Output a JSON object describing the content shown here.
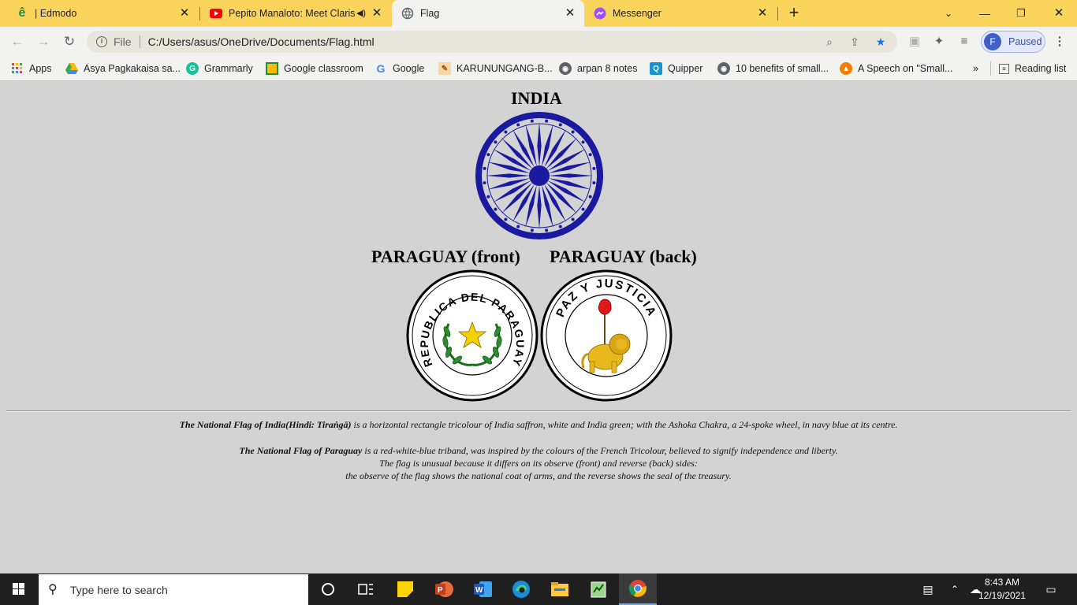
{
  "tabs": [
    {
      "title": "| Edmodo",
      "icon": "edmodo-icon",
      "active": false
    },
    {
      "title": "Pepito Manaloto: Meet Claris",
      "icon": "youtube-icon",
      "active": false,
      "audio": true
    },
    {
      "title": "Flag",
      "icon": "globe-icon",
      "active": true
    },
    {
      "title": "Messenger",
      "icon": "messenger-icon",
      "active": false
    }
  ],
  "toolbar": {
    "scheme": "File",
    "url": "C:/Users/asus/OneDrive/Documents/Flag.html",
    "profile_initial": "F",
    "profile_status": "Paused"
  },
  "bookmarks": [
    {
      "label": "Apps",
      "icon": "apps-grid-icon"
    },
    {
      "label": "Asya Pagkakaisa sa...",
      "icon": "google-drive-icon"
    },
    {
      "label": "Grammarly",
      "icon": "grammarly-icon"
    },
    {
      "label": "Google classroom",
      "icon": "classroom-icon"
    },
    {
      "label": "Google",
      "icon": "google-icon"
    },
    {
      "label": "KARUNUNGANG-B...",
      "icon": "bookmark-page-icon"
    },
    {
      "label": "arpan 8 notes",
      "icon": "globe-icon"
    },
    {
      "label": "Quipper",
      "icon": "quipper-icon"
    },
    {
      "label": "10 benefits of small...",
      "icon": "globe-icon"
    },
    {
      "label": "A Speech on \"Small...",
      "icon": "speech-icon"
    }
  ],
  "bookmarks_overflow": "»",
  "reading_list": "Reading list",
  "page": {
    "india_title": "INDIA",
    "paraguay_front_title": "PARAGUAY (front)",
    "paraguay_back_title": "PARAGUAY (back)",
    "seal_front_text": "REPUBLICA DEL PARAGUAY",
    "seal_back_text": "PAZ Y JUSTICIA",
    "india_desc_bold": "The National Flag of India(Hindi: Tiraṅgā)",
    "india_desc_rest": " is a horizontal rectangle tricolour of India saffron, white and India green; with the Ashoka Chakra, a 24-spoke wheel, in navy blue at its centre.",
    "paraguay_desc_bold": "The National Flag of Paraguay",
    "paraguay_desc_rest": " is a red-white-blue triband, was inspired by the colours of the French Tricolour, believed to signify independence and liberty.",
    "paraguay_desc_line2": "The flag is unusual because it differs on its observe (front) and reverse (back) sides:",
    "paraguay_desc_line3": "the observe of the flag shows the national coat of arms, and the reverse shows the seal of the treasury."
  },
  "taskbar": {
    "search_placeholder": "Type here to search",
    "apps": [
      "cortana-icon",
      "task-view-icon",
      "sticky-notes-icon",
      "powerpoint-icon",
      "word-icon",
      "edge-icon",
      "file-explorer-icon",
      "notepad-icon",
      "chrome-icon"
    ],
    "time": "8:43 AM",
    "date": "12/19/2021"
  },
  "colors": {
    "tabstrip": "#fbd45c",
    "chakra_blue": "#1a1aa0",
    "page_bg": "#d3d3d3"
  }
}
